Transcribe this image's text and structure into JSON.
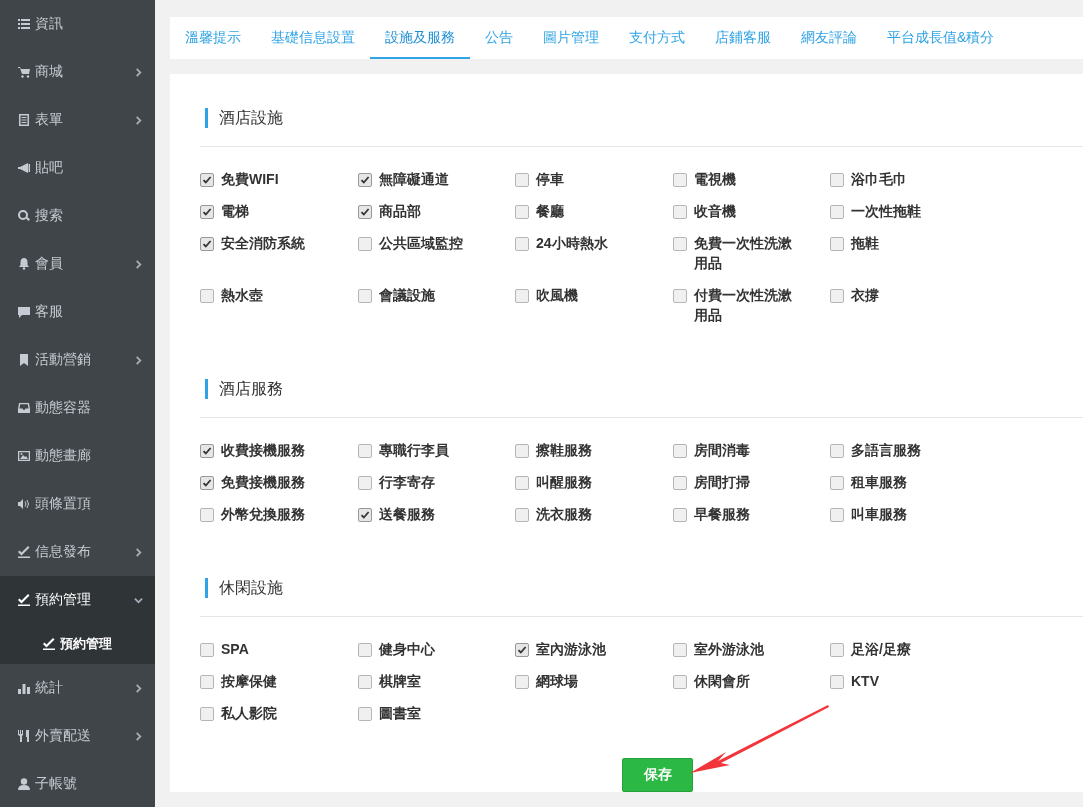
{
  "sidebar": {
    "items": [
      {
        "label": "資訊",
        "expandable": false,
        "selected": false
      },
      {
        "label": "商城",
        "expandable": true,
        "expanded": false,
        "selected": false
      },
      {
        "label": "表單",
        "expandable": true,
        "expanded": false,
        "selected": false
      },
      {
        "label": "貼吧",
        "expandable": false,
        "selected": false
      },
      {
        "label": "搜索",
        "expandable": false,
        "selected": false
      },
      {
        "label": "會員",
        "expandable": true,
        "expanded": false,
        "selected": false
      },
      {
        "label": "客服",
        "expandable": false,
        "selected": false
      },
      {
        "label": "活動營銷",
        "expandable": true,
        "expanded": false,
        "selected": false
      },
      {
        "label": "動態容器",
        "expandable": false,
        "selected": false
      },
      {
        "label": "動態畫廊",
        "expandable": false,
        "selected": false
      },
      {
        "label": "頭條置頂",
        "expandable": false,
        "selected": false
      },
      {
        "label": "信息發布",
        "expandable": true,
        "expanded": false,
        "selected": false
      },
      {
        "label": "預約管理",
        "expandable": true,
        "expanded": true,
        "selected": true,
        "children": [
          {
            "label": "預約管理",
            "selected": true
          }
        ]
      },
      {
        "label": "統計",
        "expandable": true,
        "expanded": false,
        "selected": false
      },
      {
        "label": "外賣配送",
        "expandable": true,
        "expanded": false,
        "selected": false
      },
      {
        "label": "子帳號",
        "expandable": false,
        "selected": false
      }
    ]
  },
  "tabs": [
    {
      "label": "溫馨提示",
      "selected": false
    },
    {
      "label": "基礎信息設置",
      "selected": false
    },
    {
      "label": "設施及服務",
      "selected": true
    },
    {
      "label": "公告",
      "selected": false
    },
    {
      "label": "圖片管理",
      "selected": false
    },
    {
      "label": "支付方式",
      "selected": false
    },
    {
      "label": "店鋪客服",
      "selected": false
    },
    {
      "label": "網友評論",
      "selected": false
    },
    {
      "label": "平台成長值&積分",
      "selected": false
    }
  ],
  "sections": [
    {
      "title": "酒店設施",
      "options": [
        {
          "label": "免費WIFI",
          "checked": true
        },
        {
          "label": "無障礙通道",
          "checked": true
        },
        {
          "label": "停車",
          "checked": false
        },
        {
          "label": "電視機",
          "checked": false
        },
        {
          "label": "浴巾毛巾",
          "checked": false
        },
        {
          "label": "電梯",
          "checked": true
        },
        {
          "label": "商品部",
          "checked": true
        },
        {
          "label": "餐廳",
          "checked": false
        },
        {
          "label": "收音機",
          "checked": false
        },
        {
          "label": "一次性拖鞋",
          "checked": false
        },
        {
          "label": "安全消防系統",
          "checked": true
        },
        {
          "label": "公共區域監控",
          "checked": false
        },
        {
          "label": "24小時熱水",
          "checked": false
        },
        {
          "label": "免費一次性洗漱用品",
          "checked": false
        },
        {
          "label": "拖鞋",
          "checked": false
        },
        {
          "label": "熱水壺",
          "checked": false
        },
        {
          "label": "會議設施",
          "checked": false
        },
        {
          "label": "吹風機",
          "checked": false
        },
        {
          "label": "付費一次性洗漱用品",
          "checked": false
        },
        {
          "label": "衣撐",
          "checked": false
        }
      ]
    },
    {
      "title": "酒店服務",
      "options": [
        {
          "label": "收費接機服務",
          "checked": true
        },
        {
          "label": "專職行李員",
          "checked": false
        },
        {
          "label": "擦鞋服務",
          "checked": false
        },
        {
          "label": "房間消毒",
          "checked": false
        },
        {
          "label": "多語言服務",
          "checked": false
        },
        {
          "label": "免費接機服務",
          "checked": true
        },
        {
          "label": "行李寄存",
          "checked": false
        },
        {
          "label": "叫醒服務",
          "checked": false
        },
        {
          "label": "房間打掃",
          "checked": false
        },
        {
          "label": "租車服務",
          "checked": false
        },
        {
          "label": "外幣兌換服務",
          "checked": false
        },
        {
          "label": "送餐服務",
          "checked": true
        },
        {
          "label": "洗衣服務",
          "checked": false
        },
        {
          "label": "早餐服務",
          "checked": false
        },
        {
          "label": "叫車服務",
          "checked": false
        }
      ]
    },
    {
      "title": "休閑設施",
      "options": [
        {
          "label": "SPA",
          "checked": false
        },
        {
          "label": "健身中心",
          "checked": false
        },
        {
          "label": "室內游泳池",
          "checked": true
        },
        {
          "label": "室外游泳池",
          "checked": false
        },
        {
          "label": "足浴/足療",
          "checked": false
        },
        {
          "label": "按摩保健",
          "checked": false
        },
        {
          "label": "棋牌室",
          "checked": false
        },
        {
          "label": "網球場",
          "checked": false
        },
        {
          "label": "休閑會所",
          "checked": false
        },
        {
          "label": "KTV",
          "checked": false
        },
        {
          "label": "私人影院",
          "checked": false
        },
        {
          "label": "圖書室",
          "checked": false
        }
      ]
    }
  ],
  "save_button": "保存"
}
